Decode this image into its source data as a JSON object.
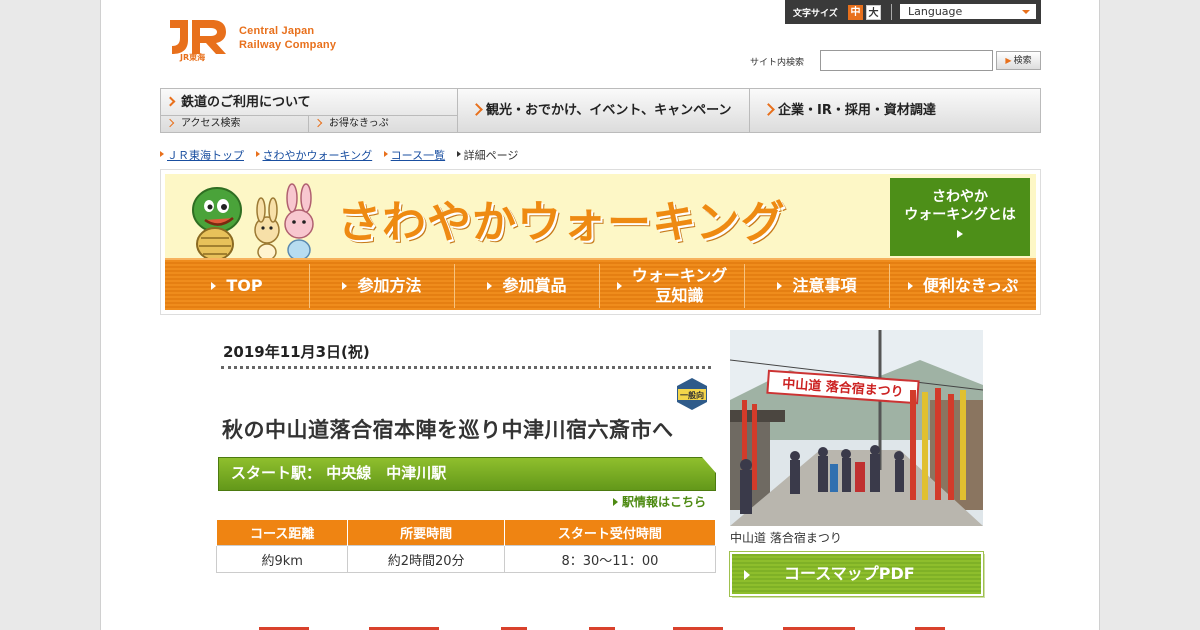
{
  "header": {
    "logo_text_line1": "Central Japan",
    "logo_text_line2": "Railway Company",
    "logo_sub": "JR東海",
    "font_size_label": "文字サイズ",
    "font_size_mid": "中",
    "font_size_big": "大",
    "language_label": "Language",
    "search_label": "サイト内検索",
    "search_value": "",
    "search_button": "検索"
  },
  "gnav": {
    "rail": "鉄道のご利用について",
    "rail_sub1": "アクセス検索",
    "rail_sub2": "お得なきっぷ",
    "sightseeing": "観光・おでかけ、イベント、キャンペーン",
    "corporate": "企業・IR・採用・資材調達"
  },
  "breadcrumb": [
    "ＪＲ東海トップ",
    "さわやかウォーキング",
    "コース一覧",
    "詳細ページ"
  ],
  "banner": {
    "title": "さわやかウォーキング",
    "about_line1": "さわやか",
    "about_line2": "ウォーキングとは",
    "tabs": [
      "TOP",
      "参加方法",
      "参加賞品",
      "ウォーキング豆知識",
      "注意事項",
      "便利なきっぷ"
    ],
    "tab_trivia_line1": "ウォーキング",
    "tab_trivia_line2": "豆知識"
  },
  "course": {
    "date": "2019年11月3日(祝)",
    "badge": "一般向",
    "title": "秋の中山道落合宿本陣を巡り中津川宿六斎市へ",
    "start_station": "スタート駅： 中央線　中津川駅",
    "station_link": "駅情報はこちら",
    "table_headers": [
      "コース距離",
      "所要時間",
      "スタート受付時間"
    ],
    "table_values": [
      "約9km",
      "約2時間20分",
      "8：30～11：00"
    ],
    "photo_banner_text": "中山道 落合宿まつり",
    "photo_caption": "中山道 落合宿まつり",
    "pdf_button": "コースマップPDF"
  },
  "colors": {
    "accent_orange": "#e8701c",
    "walking_green": "#4d8f18",
    "tab_orange": "#ef8c1c"
  }
}
